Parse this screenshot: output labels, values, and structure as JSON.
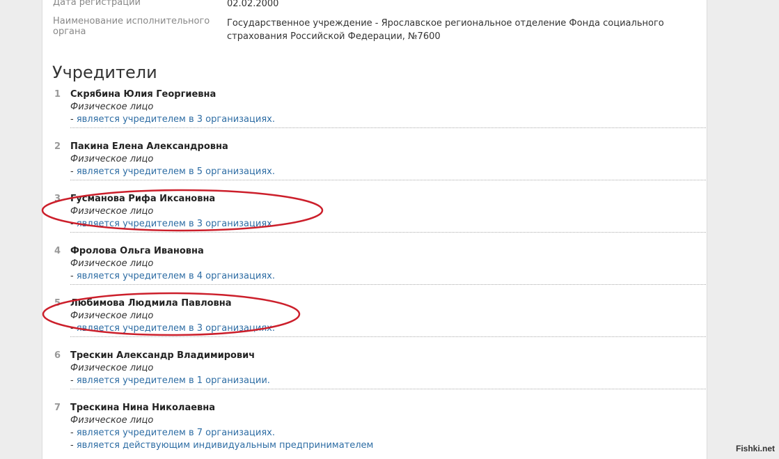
{
  "info": [
    {
      "label": "Дата регистрации",
      "value": "02.02.2000"
    },
    {
      "label": "Наименование исполнительного органа",
      "value": "Государственное учреждение - Ярославское региональное отделение Фонда социального страхования Российской Федерации, №7600"
    }
  ],
  "section_title": "Учредители",
  "founders": [
    {
      "num": "1",
      "name": "Скрябина Юлия Георгиевна",
      "type": "Физическое лицо",
      "lines": [
        {
          "prefix": "- ",
          "text": "является учредителем в 3 организациях."
        }
      ]
    },
    {
      "num": "2",
      "name": "Пакина Елена Александровна",
      "type": "Физическое лицо",
      "lines": [
        {
          "prefix": "- ",
          "text": "является учредителем в 5 организациях."
        }
      ]
    },
    {
      "num": "3",
      "name": "Гусманова Рифа Иксановна",
      "type": "Физическое лицо",
      "lines": [
        {
          "prefix": "- ",
          "text": "является учредителем в 3 организациях."
        }
      ]
    },
    {
      "num": "4",
      "name": "Фролова Ольга Ивановна",
      "type": "Физическое лицо",
      "lines": [
        {
          "prefix": "- ",
          "text": "является учредителем в 4 организациях."
        }
      ]
    },
    {
      "num": "5",
      "name": "Любимова Людмила Павловна",
      "type": "Физическое лицо",
      "lines": [
        {
          "prefix": "- ",
          "text": "является учредителем в 3 организациях."
        }
      ]
    },
    {
      "num": "6",
      "name": "Трескин Александр Владимирович",
      "type": "Физическое лицо",
      "lines": [
        {
          "prefix": "- ",
          "text": "является учредителем в 1 организации."
        }
      ]
    },
    {
      "num": "7",
      "name": "Трескина Нина Николаевна",
      "type": "Физическое лицо",
      "lines": [
        {
          "prefix": "- ",
          "text": "является учредителем в 7 организациях."
        },
        {
          "prefix": "- ",
          "text": "является действующим индивидуальным предпринимателем"
        }
      ]
    }
  ],
  "annotation_color": "#cc1f2b",
  "watermark": "Fishki.net"
}
